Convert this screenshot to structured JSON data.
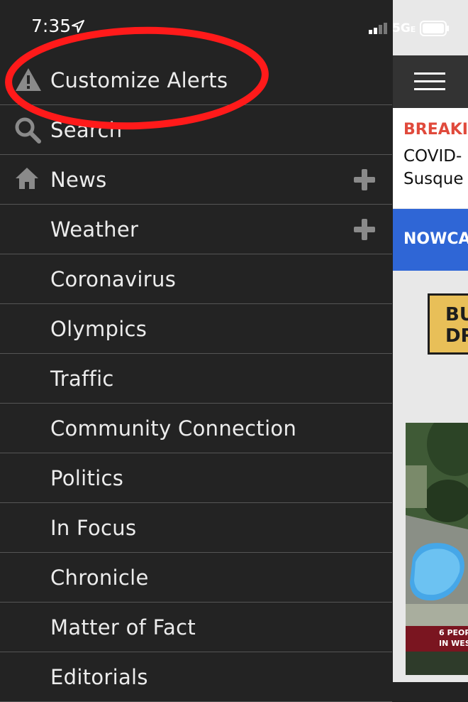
{
  "status_bar": {
    "time": "7:35",
    "network": "5G",
    "network_suffix": "E"
  },
  "drawer": {
    "items": [
      {
        "label": "Customize Alerts",
        "icon": "warning-icon"
      },
      {
        "label": "Search",
        "icon": "search-icon"
      },
      {
        "label": "News",
        "icon": "home-icon",
        "expandable": true
      },
      {
        "label": "Weather",
        "expandable": true
      },
      {
        "label": "Coronavirus"
      },
      {
        "label": "Olympics"
      },
      {
        "label": "Traffic"
      },
      {
        "label": "Community Connection"
      },
      {
        "label": "Politics"
      },
      {
        "label": "In Focus"
      },
      {
        "label": "Chronicle"
      },
      {
        "label": "Matter of Fact"
      },
      {
        "label": "Editorials"
      }
    ]
  },
  "page": {
    "breaking": "BREAKI",
    "headline_line1": "COVID-",
    "headline_line2": "Susque",
    "nowcast": "NOWCA",
    "promo_text": "BU\nDR",
    "photo_caption_line1": "6 PEOP",
    "photo_caption_line2": "IN WES"
  },
  "colors": {
    "drawer_bg": "#232323",
    "divider": "#555555",
    "breaking_red": "#e04a3c",
    "nowcast_blue": "#2f66d6",
    "annotation_red": "#ff1a1a"
  }
}
